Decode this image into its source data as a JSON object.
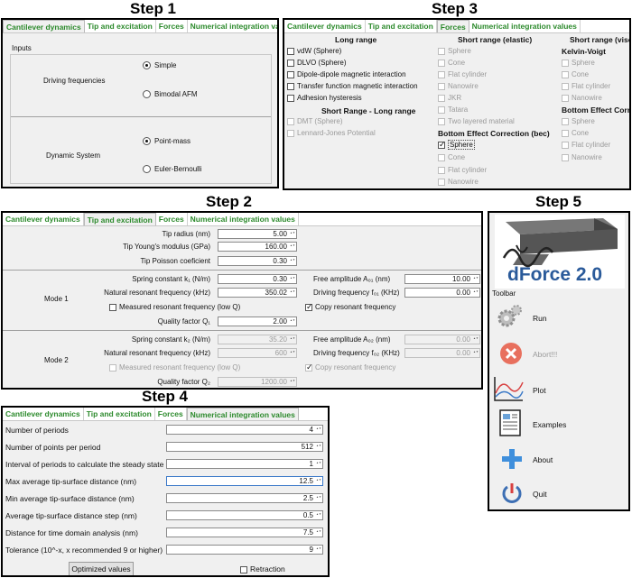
{
  "steps": {
    "s1": "Step 1",
    "s2": "Step 2",
    "s3": "Step 3",
    "s4": "Step 4",
    "s5": "Step 5"
  },
  "tabs": [
    "Cantilever dynamics",
    "Tip and excitation",
    "Forces",
    "Numerical integration values"
  ],
  "step1": {
    "inputs_label": "Inputs",
    "driving_label": "Driving frequencies",
    "simple": "Simple",
    "bimodal": "Bimodal AFM",
    "system_label": "Dynamic System",
    "point_mass": "Point-mass",
    "euler": "Euler-Bernoulli"
  },
  "step3": {
    "long_range_title": "Long range",
    "long_range": [
      "vdW (Sphere)",
      "DLVO (Sphere)",
      "Dipole-dipole magnetic interaction",
      "Transfer function magnetic interaction",
      "Adhesion hysteresis"
    ],
    "short_long_title": "Short Range - Long range",
    "short_long": [
      "DMT (Sphere)",
      "Lennard-Jones Potential"
    ],
    "elastic_title": "Short range (elastic)",
    "elastic": [
      "Sphere",
      "Cone",
      "Flat cylinder",
      "Nanowire",
      "JKR",
      "Tatara",
      "Two layered material"
    ],
    "bec_title": "Bottom Effect Correction (bec)",
    "bec": [
      "Sphere",
      "Cone",
      "Flat cylinder",
      "Nanowire"
    ],
    "visco_title": "Short range (visco",
    "kelvin_title": "Kelvin-Voigt",
    "kelvin": [
      "Sphere",
      "Cone",
      "Flat cylinder",
      "Nanowire"
    ],
    "bec2_title": "Bottom Effect Correc",
    "bec2": [
      "Sphere",
      "Cone",
      "Flat cylinder",
      "Nanowire"
    ]
  },
  "step2": {
    "tip_radius_label": "Tip radius (nm)",
    "tip_radius": "5.00",
    "tip_young_label": "Tip Young's modulus (GPa)",
    "tip_young": "160.00",
    "tip_poisson_label": "Tip Poisson coeficient",
    "tip_poisson": "0.30",
    "mode1_label": "Mode 1",
    "spring1_label": "Spring constant k₁ (N/m)",
    "spring1": "0.30",
    "freeamp1_label": "Free amplitude A₀₁ (nm)",
    "freeamp1": "10.00",
    "natfreq1_label": "Natural resonant frequency (kHz)",
    "natfreq1": "350.02",
    "drive1_label": "Driving frequency f₀₁ (KHz)",
    "drive1": "0.00",
    "measured1_label": "Measured resonant frequency (low Q)",
    "copy1_label": "Copy resonant frequency",
    "q1_label": "Quality factor Q₁",
    "q1": "2.00",
    "mode2_label": "Mode 2",
    "spring2_label": "Spring constant k₂ (N/m)",
    "spring2": "35.20",
    "freeamp2_label": "Free amplitude A₀₂ (nm)",
    "freeamp2": "0.00",
    "natfreq2_label": "Natural resonant frequency (kHz)",
    "natfreq2": "600",
    "drive2_label": "Driving frequency f₀₂ (KHz)",
    "drive2": "0.00",
    "measured2_label": "Measured resonant frequency (low Q)",
    "copy2_label": "Copy resonant frequency",
    "q2_label": "Quality factor Q₂",
    "q2": "1200.00"
  },
  "step4": {
    "rows": [
      {
        "label": "Number of periods",
        "value": "4"
      },
      {
        "label": "Number of points per period",
        "value": "512"
      },
      {
        "label": "Interval of periods to calculate the steady state",
        "value": "1"
      },
      {
        "label": "Max average tip-surface distance (nm)",
        "value": "12.5"
      },
      {
        "label": "Min average tip-surface distance (nm)",
        "value": "2.5"
      },
      {
        "label": "Average tip-surface distance step (nm)",
        "value": "0.5"
      },
      {
        "label": "Distance for time domain analysis (nm)",
        "value": "7.5"
      },
      {
        "label": "Tolerance (10^-x, x recommended 9 or higher)",
        "value": "9"
      }
    ],
    "optimized": "Optimized values",
    "retraction": "Retraction"
  },
  "step5": {
    "logo": "dForce 2.0",
    "toolbar": "Toolbar",
    "run": "Run",
    "abort": "Abort!!!",
    "plot": "Plot",
    "examples": "Examples",
    "about": "About",
    "quit": "Quit"
  },
  "colors": {
    "tab_text": "#2c8a2c",
    "abort": "#e8705e",
    "about": "#3f8fdc",
    "quit": "#3d6fb4"
  }
}
